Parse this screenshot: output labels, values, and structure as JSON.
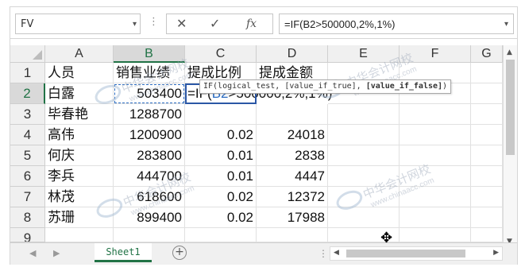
{
  "formula_bar": {
    "name_box": "FV",
    "cancel_icon": "cancel-icon",
    "enter_icon": "check-icon",
    "fx_label": "fx",
    "formula": "=IF(B2>500000,2%,1%)"
  },
  "grid": {
    "columns": [
      "A",
      "B",
      "C",
      "D",
      "E",
      "F",
      "G"
    ],
    "rows": [
      "1",
      "2",
      "3",
      "4",
      "5",
      "6",
      "7",
      "8",
      "9"
    ],
    "header_row": [
      "人员",
      "销售业绩",
      "提成比例",
      "提成金额"
    ],
    "data": [
      {
        "name": "白露",
        "sales": "503400",
        "rate": "",
        "amount": ""
      },
      {
        "name": "毕春艳",
        "sales": "1288700",
        "rate": "",
        "amount": ""
      },
      {
        "name": "高伟",
        "sales": "1200900",
        "rate": "0.02",
        "amount": "24018"
      },
      {
        "name": "何庆",
        "sales": "283800",
        "rate": "0.01",
        "amount": "2838"
      },
      {
        "name": "李兵",
        "sales": "444700",
        "rate": "0.01",
        "amount": "4447"
      },
      {
        "name": "林茂",
        "sales": "618600",
        "rate": "0.02",
        "amount": "12372"
      },
      {
        "name": "苏珊",
        "sales": "899400",
        "rate": "0.02",
        "amount": "17988"
      }
    ],
    "editing_cell": {
      "prefix": "=IF(",
      "ref": "B2",
      "suffix": ">500000,2%,1%)"
    },
    "tooltip": {
      "text": "IF(logical_test, [value_if_true], ",
      "bold": "[value_if_false]",
      "end": ")"
    }
  },
  "sheet_tabs": {
    "active": "Sheet1",
    "add_icon": "plus-icon"
  },
  "watermark": {
    "name": "中华会计网校",
    "url": "www.chinaacc.com"
  }
}
